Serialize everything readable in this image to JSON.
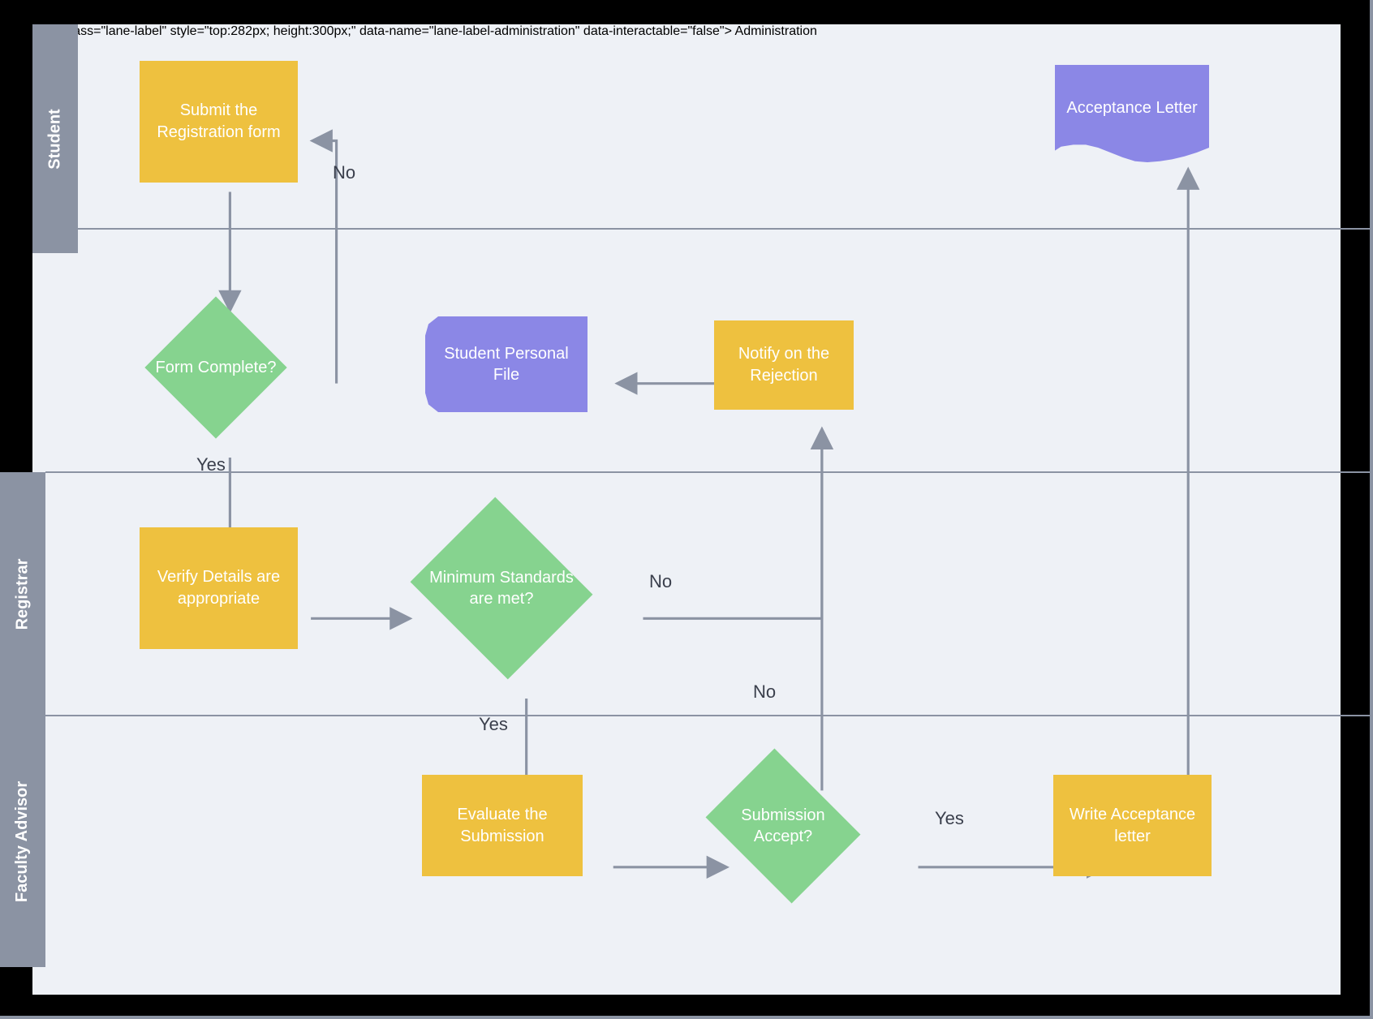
{
  "colors": {
    "process": "#eec13f",
    "decision": "#86d38f",
    "document": "#8b87e6",
    "lane_header": "#8b93a3",
    "canvas": "#eef1f6",
    "connector": "#8b93a3"
  },
  "lanes": [
    {
      "id": "student",
      "label": "Student"
    },
    {
      "id": "admin",
      "label": "Administration"
    },
    {
      "id": "registrar",
      "label": "Registrar"
    },
    {
      "id": "faculty",
      "label": "Faculty Advisor"
    }
  ],
  "nodes": {
    "submit_form": {
      "lane": "student",
      "type": "process",
      "text": "Submit the Registration form"
    },
    "acceptance_letter_doc": {
      "lane": "student",
      "type": "document",
      "text": "Acceptance Letter"
    },
    "form_complete": {
      "lane": "admin",
      "type": "decision",
      "text": "Form Complete?"
    },
    "student_file": {
      "lane": "admin",
      "type": "document",
      "text": "Student Personal File"
    },
    "notify_rejection": {
      "lane": "admin",
      "type": "process",
      "text": "Notify on the Rejection"
    },
    "verify_details": {
      "lane": "registrar",
      "type": "process",
      "text": "Verify Details are appropriate"
    },
    "min_standards": {
      "lane": "registrar",
      "type": "decision",
      "text": "Minimum Standards  are met?"
    },
    "evaluate_submission": {
      "lane": "faculty",
      "type": "process",
      "text": "Evaluate the Submission"
    },
    "submission_accept": {
      "lane": "faculty",
      "type": "decision",
      "text": "Submission Accept?"
    },
    "write_acceptance": {
      "lane": "faculty",
      "type": "process",
      "text": "Write Acceptance letter"
    }
  },
  "edges": [
    {
      "from": "submit_form",
      "to": "form_complete",
      "label": ""
    },
    {
      "from": "form_complete",
      "to": "submit_form",
      "label": "No"
    },
    {
      "from": "form_complete",
      "to": "verify_details",
      "label": "Yes"
    },
    {
      "from": "verify_details",
      "to": "min_standards",
      "label": ""
    },
    {
      "from": "min_standards",
      "to": "evaluate_submission",
      "label": "Yes"
    },
    {
      "from": "min_standards",
      "to": "notify_rejection",
      "label": "No",
      "via": "right-up"
    },
    {
      "from": "notify_rejection",
      "to": "student_file",
      "label": ""
    },
    {
      "from": "evaluate_submission",
      "to": "submission_accept",
      "label": ""
    },
    {
      "from": "submission_accept",
      "to": "notify_rejection",
      "label": "No"
    },
    {
      "from": "submission_accept",
      "to": "write_acceptance",
      "label": "Yes"
    },
    {
      "from": "write_acceptance",
      "to": "acceptance_letter_doc",
      "label": ""
    }
  ],
  "edge_labels": {
    "no": "No",
    "yes": "Yes"
  }
}
